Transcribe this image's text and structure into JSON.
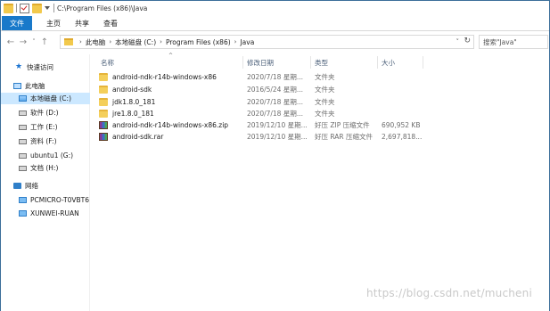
{
  "window": {
    "title": "C:\\Program Files (x86)\\Java"
  },
  "ribbon": {
    "tabs": [
      "文件",
      "主页",
      "共享",
      "查看"
    ]
  },
  "address": {
    "breadcrumbs": [
      "此电脑",
      "本地磁盘 (C:)",
      "Program Files (x86)",
      "Java"
    ],
    "search_placeholder": "搜索\"Java\""
  },
  "navigation": {
    "quick_access": "快速访问",
    "this_pc": "此电脑",
    "drives": [
      "本地磁盘 (C:)",
      "软件 (D:)",
      "工作 (E:)",
      "资料 (F:)",
      "ubuntu1 (G:)",
      "文档 (H:)"
    ],
    "network": "网络",
    "network_items": [
      "PCMICRO-T0VBT6",
      "XUNWEI-RUAN"
    ]
  },
  "columns": {
    "name": "名称",
    "date": "修改日期",
    "type": "类型",
    "size": "大小"
  },
  "files": [
    {
      "name": "android-ndk-r14b-windows-x86",
      "date": "2020/7/18 星期...",
      "type": "文件夹",
      "size": "",
      "icon": "folder-icon"
    },
    {
      "name": "android-sdk",
      "date": "2016/5/24 星期...",
      "type": "文件夹",
      "size": "",
      "icon": "folder-icon"
    },
    {
      "name": "jdk1.8.0_181",
      "date": "2020/7/18 星期...",
      "type": "文件夹",
      "size": "",
      "icon": "folder-icon"
    },
    {
      "name": "jre1.8.0_181",
      "date": "2020/7/18 星期...",
      "type": "文件夹",
      "size": "",
      "icon": "folder-icon"
    },
    {
      "name": "android-ndk-r14b-windows-x86.zip",
      "date": "2019/12/10 星期...",
      "type": "好压 ZIP 压缩文件",
      "size": "690,952 KB",
      "icon": "archive-icon"
    },
    {
      "name": "android-sdk.rar",
      "date": "2019/12/10 星期...",
      "type": "好压 RAR 压缩文件",
      "size": "2,697,818...",
      "icon": "archive-icon"
    }
  ],
  "watermark": "https://blog.csdn.net/mucheni",
  "colors": {
    "file_tab": "#1979ca",
    "selected": "#cce8ff",
    "header_text": "#4c607a"
  }
}
